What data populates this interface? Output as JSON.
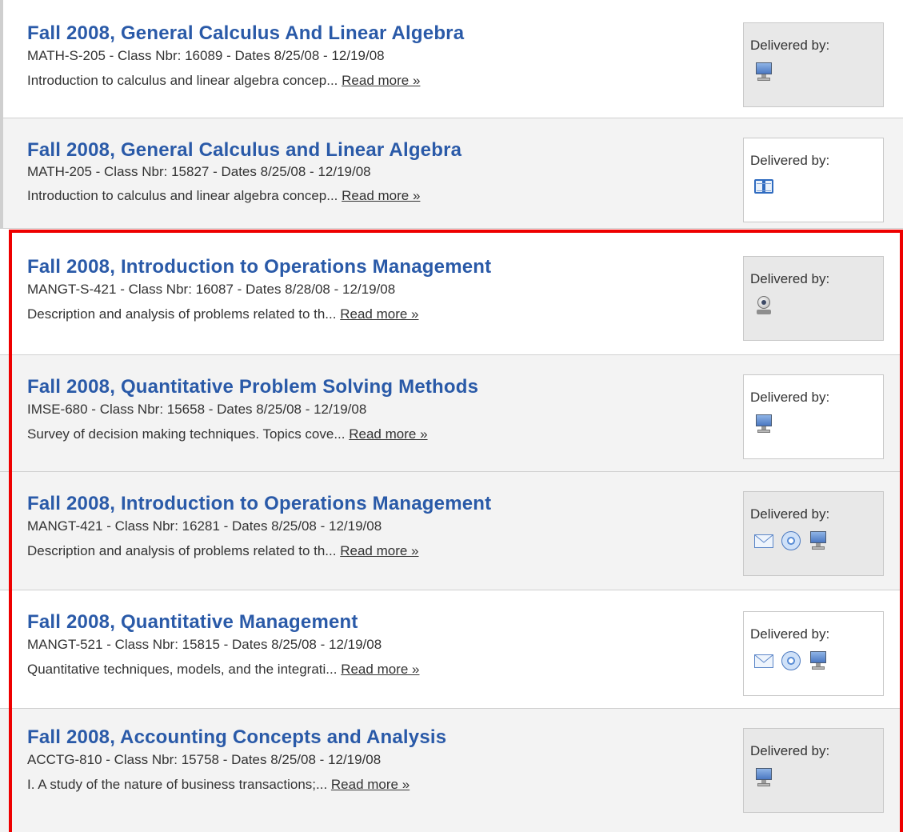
{
  "courses": [
    {
      "title": "Fall 2008, General Calculus And Linear Algebra",
      "meta": "MATH-S-205 - Class Nbr: 16089 - Dates 8/25/08 - 12/19/08",
      "desc": "Introduction to calculus and linear algebra concep...",
      "read_more": "Read more »",
      "delivered_label": "Delivered by:",
      "icons": [
        "computer-icon"
      ]
    },
    {
      "title": "Fall 2008, General Calculus and Linear Algebra",
      "meta": "MATH-205 - Class Nbr: 15827 - Dates 8/25/08 - 12/19/08",
      "desc": "Introduction to calculus and linear algebra concep...",
      "read_more": "Read more »",
      "delivered_label": "Delivered by:",
      "icons": [
        "book-icon"
      ]
    },
    {
      "title": "Fall 2008, Introduction to Operations Management",
      "meta": "MANGT-S-421 - Class Nbr: 16087 - Dates 8/28/08 - 12/19/08",
      "desc": "Description and analysis of problems related to th...",
      "read_more": "Read more »",
      "delivered_label": "Delivered by:",
      "icons": [
        "webcam-icon"
      ]
    },
    {
      "title": "Fall 2008, Quantitative Problem Solving Methods",
      "meta": "IMSE-680 - Class Nbr: 15658 - Dates 8/25/08 - 12/19/08",
      "desc": "Survey of decision making techniques. Topics cove...",
      "read_more": "Read more »",
      "delivered_label": "Delivered by:",
      "icons": [
        "computer-icon"
      ]
    },
    {
      "title": "Fall 2008, Introduction to Operations Management",
      "meta": "MANGT-421 - Class Nbr: 16281 - Dates 8/25/08 - 12/19/08",
      "desc": "Description and analysis of problems related to th...",
      "read_more": "Read more »",
      "delivered_label": "Delivered by:",
      "icons": [
        "mail-icon",
        "disc-icon",
        "computer-icon"
      ]
    },
    {
      "title": "Fall 2008, Quantitative Management",
      "meta": "MANGT-521 - Class Nbr: 15815 - Dates 8/25/08 - 12/19/08",
      "desc": "Quantitative techniques, models, and the integrati...",
      "read_more": "Read more »",
      "delivered_label": "Delivered by:",
      "icons": [
        "mail-icon",
        "disc-icon",
        "computer-icon"
      ]
    },
    {
      "title": "Fall 2008, Accounting Concepts and Analysis",
      "meta": "ACCTG-810 - Class Nbr: 15758 - Dates 8/25/08 - 12/19/08",
      "desc": "I. A study of the nature of business transactions;...",
      "read_more": "Read more »",
      "delivered_label": "Delivered by:",
      "icons": [
        "computer-icon"
      ]
    }
  ],
  "colors": {
    "title_link": "#2a5aa8",
    "highlight_border": "#ee0000",
    "row_alt_bg": "#f3f3f3"
  }
}
